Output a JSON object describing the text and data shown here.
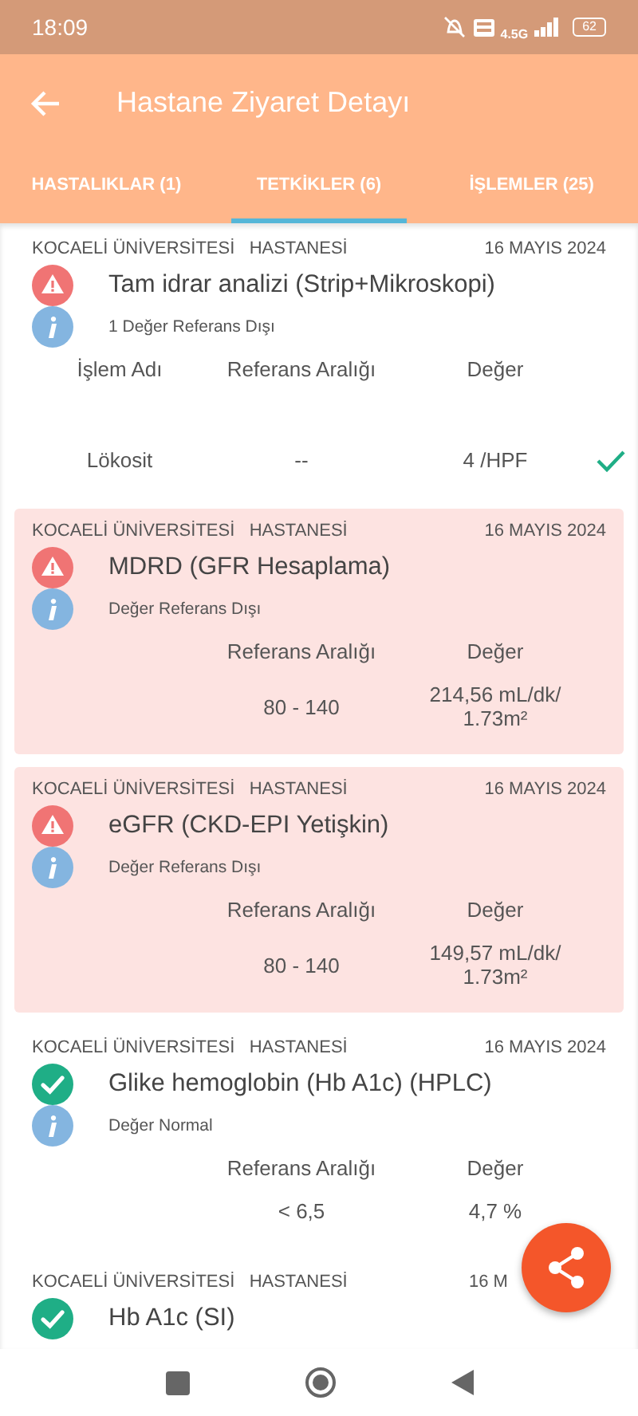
{
  "status_bar": {
    "time": "18:09",
    "network": "4.5G",
    "battery": "62"
  },
  "toolbar": {
    "title": "Hastane Ziyaret Detayı"
  },
  "tabs": [
    {
      "label": "HASTALIKLAR (1)",
      "selected": false
    },
    {
      "label": "TETKİKLER (6)",
      "selected": true
    },
    {
      "label": "İŞLEMLER (25)",
      "selected": false
    }
  ],
  "tests": [
    {
      "hospital": "KOCAELİ ÜNİVERSİTESİ   HASTANESİ",
      "date": "16 MAYIS 2024",
      "kind": "warning",
      "highlighted": false,
      "title": "Tam idrar analizi (Strip+Mikroskopi)",
      "note": "1 Değer Referans Dışı",
      "columns": [
        "İşlem Adı",
        "Referans Aralığı",
        "Değer"
      ],
      "rows": [
        {
          "name": "Lökosit",
          "range": "--",
          "value": "4 /HPF",
          "checked": true
        }
      ]
    },
    {
      "hospital": "KOCAELİ ÜNİVERSİTESİ   HASTANESİ",
      "date": "16 MAYIS 2024",
      "kind": "warning",
      "highlighted": true,
      "title": "MDRD (GFR Hesaplama)",
      "note": "Değer Referans Dışı",
      "columns": [
        "Referans Aralığı",
        "Değer"
      ],
      "rows": [
        {
          "range": "80 - 140",
          "value": "214,56 mL/dk/ 1.73m²"
        }
      ]
    },
    {
      "hospital": "KOCAELİ ÜNİVERSİTESİ   HASTANESİ",
      "date": "16 MAYIS 2024",
      "kind": "warning",
      "highlighted": true,
      "title": "eGFR (CKD-EPI Yetişkin)",
      "note": "Değer Referans Dışı",
      "columns": [
        "Referans Aralığı",
        "Değer"
      ],
      "rows": [
        {
          "range": "80 - 140",
          "value": "149,57 mL/dk/ 1.73m²"
        }
      ]
    },
    {
      "hospital": "KOCAELİ ÜNİVERSİTESİ   HASTANESİ",
      "date": "16 MAYIS 2024",
      "kind": "normal",
      "highlighted": false,
      "title": "Glike hemoglobin (Hb A1c) (HPLC)",
      "note": "Değer Normal",
      "columns": [
        "Referans Aralığı",
        "Değer"
      ],
      "rows": [
        {
          "range": "< 6,5",
          "value": "4,7 %"
        }
      ]
    },
    {
      "hospital": "KOCAELİ ÜNİVERSİTESİ   HASTANESİ",
      "date": "16 M",
      "kind": "normal",
      "highlighted": false,
      "title": "Hb A1c (SI)"
    }
  ]
}
